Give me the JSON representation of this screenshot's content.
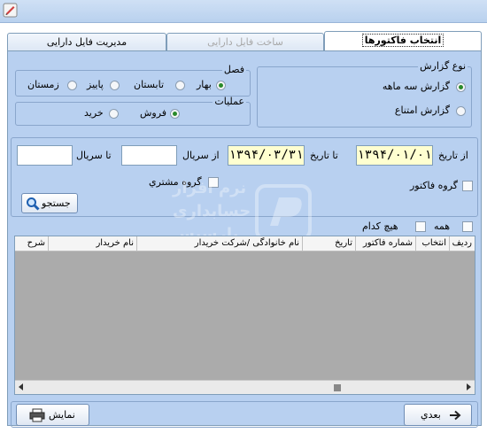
{
  "tabs": {
    "select_invoices": "انتخاب فاکتورها",
    "build_asset_file": "ساخت فایل دارایی",
    "manage_asset_file": "مدیریت فایل دارایی"
  },
  "report_type": {
    "legend": "نوع گزارش",
    "quarterly": "گزارش سه ماهه",
    "refusal": "گزارش امتناع"
  },
  "season": {
    "legend": "فصل",
    "spring": "بهار",
    "summer": "تابستان",
    "autumn": "پاییز",
    "winter": "زمستان"
  },
  "operations": {
    "legend": "عملیات",
    "sale": "فروش",
    "purchase": "خرید"
  },
  "filters": {
    "from_date_label": "از تاریخ",
    "from_date": "۱۳۹۴/۰۱/۰۱",
    "to_date_label": "تا تاریخ",
    "to_date": "۱۳۹۴/۰۳/۳۱",
    "from_serial_label": "از سریال",
    "from_serial": "",
    "to_serial_label": "تا سریال",
    "to_serial": "",
    "invoice_group": "گروه فاکتور",
    "customer_group": "گروه مشتري",
    "search_button": "جستجو"
  },
  "selection": {
    "all": "همه",
    "none": "هیچ کدام"
  },
  "grid": {
    "columns": [
      "ردیف",
      "انتخاب",
      "شماره فاکتور",
      "تاریخ",
      "نام خانوادگی /شرکت خریدار",
      "نام خریدار",
      "شرح"
    ]
  },
  "buttons": {
    "next": "بعدي",
    "show": "نمایش"
  },
  "watermark": {
    "line1": "نرم افزار",
    "line2": "حسابداری",
    "line3": "پارسیس"
  },
  "colors": {
    "panel_bg": "#b8d0f0",
    "date_bg": "#ffffd0",
    "grid_bg": "#ababab"
  }
}
